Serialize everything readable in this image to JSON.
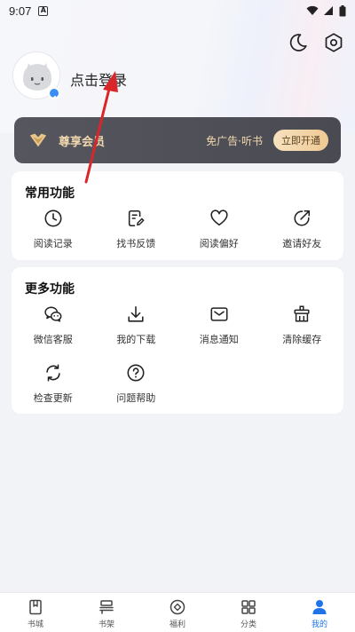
{
  "status_bar": {
    "time": "9:07"
  },
  "profile": {
    "login_text": "点击登录"
  },
  "vip": {
    "title": "尊享会员",
    "benefit": "免广告·听书",
    "button": "立即开通"
  },
  "common_functions": {
    "title": "常用功能",
    "items": [
      {
        "label": "阅读记录",
        "icon": "clock-icon"
      },
      {
        "label": "找书反馈",
        "icon": "feedback-icon"
      },
      {
        "label": "阅读偏好",
        "icon": "heart-icon"
      },
      {
        "label": "邀请好友",
        "icon": "invite-icon"
      }
    ]
  },
  "more_functions": {
    "title": "更多功能",
    "items": [
      {
        "label": "微信客服",
        "icon": "wechat-icon"
      },
      {
        "label": "我的下载",
        "icon": "download-icon"
      },
      {
        "label": "消息通知",
        "icon": "mail-icon"
      },
      {
        "label": "清除缓存",
        "icon": "broom-icon"
      },
      {
        "label": "检查更新",
        "icon": "refresh-icon"
      },
      {
        "label": "问题帮助",
        "icon": "help-icon"
      }
    ]
  },
  "bottom_nav": {
    "items": [
      {
        "label": "书城",
        "icon": "book-icon",
        "active": false
      },
      {
        "label": "书架",
        "icon": "shelf-icon",
        "active": false
      },
      {
        "label": "福利",
        "icon": "gift-icon",
        "active": false
      },
      {
        "label": "分类",
        "icon": "grid-icon",
        "active": false
      },
      {
        "label": "我的",
        "icon": "user-icon",
        "active": true
      }
    ]
  },
  "colors": {
    "accent": "#1e74e8",
    "vip_gold": "#f1d7ae",
    "annotation_arrow": "#d8262b"
  }
}
